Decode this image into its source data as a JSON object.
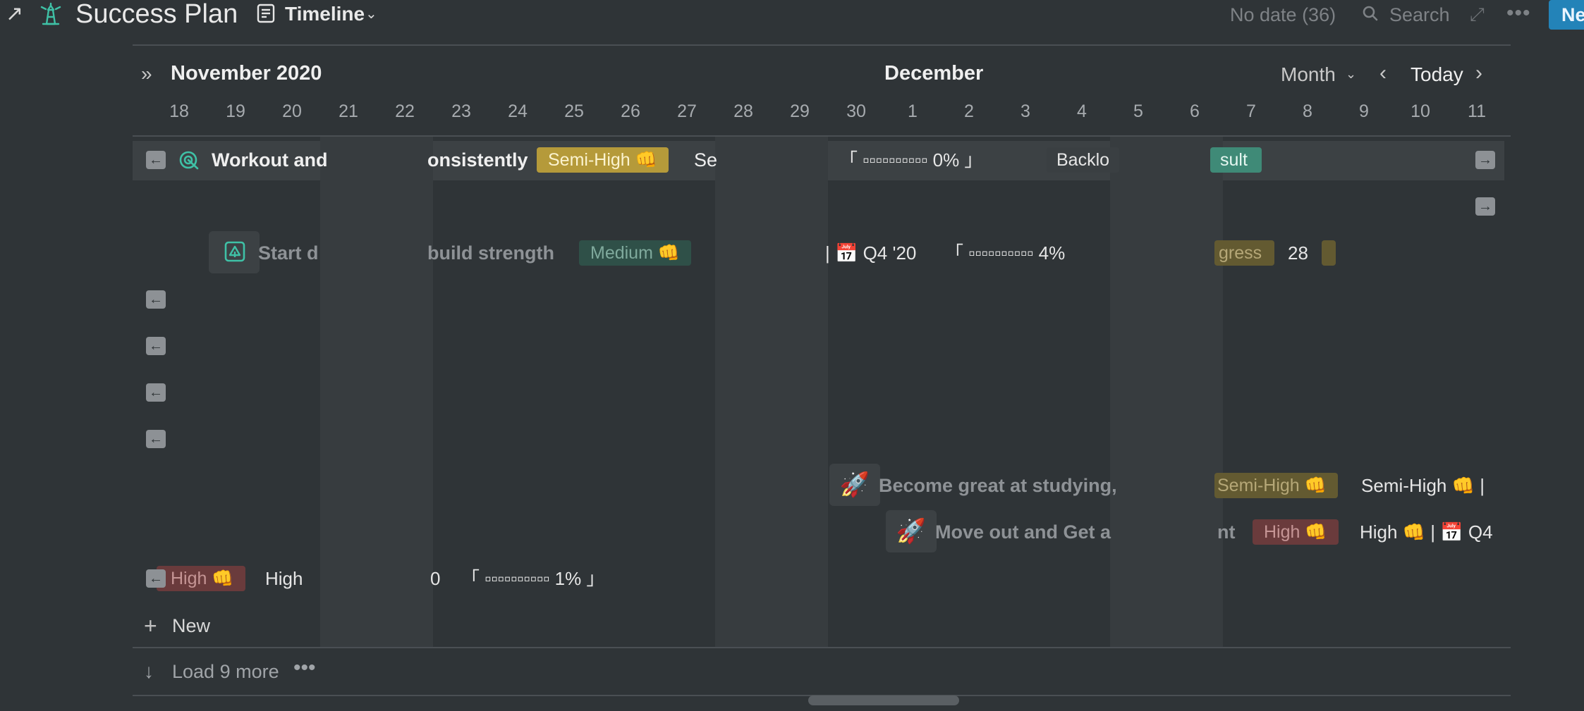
{
  "header": {
    "title": "Success Plan",
    "view_label": "Timeline",
    "no_date": "No date (36)",
    "search_label": "Search",
    "new_label": "New"
  },
  "timeline": {
    "month_left": "November 2020",
    "month_center": "December",
    "scale_label": "Month",
    "today_label": "Today",
    "days": [
      "18",
      "19",
      "20",
      "21",
      "22",
      "23",
      "24",
      "25",
      "26",
      "27",
      "28",
      "29",
      "30",
      "1",
      "2",
      "3",
      "4",
      "5",
      "6",
      "7",
      "8",
      "9",
      "10",
      "11"
    ]
  },
  "rows": {
    "r1": {
      "title_a": "Workout and",
      "title_b": "onsistently",
      "tag": "Semi-High ",
      "tag_emoji": "👊",
      "after_tag": "Se",
      "progress": "「 ▫▫▫▫▫▫▫▫▫▫ 0% 」",
      "backlog": "Backlo",
      "result": "sult"
    },
    "r2": {
      "title_a": "Start d",
      "title_b": "build strength",
      "tag": "Medium ",
      "tag_emoji": "👊",
      "quarter": "| 📅 Q4 '20",
      "progress": "「 ▫▫▫▫▫▫▫▫▫▫ 4%",
      "status": "gress",
      "number": "28"
    },
    "r3": {
      "title": "Become great at studying,",
      "tag": "Semi-High ",
      "tag_emoji": "👊",
      "after_tag": "Semi-High 👊 |"
    },
    "r4": {
      "title_a": "Move out and Get a",
      "title_b": "nt",
      "tag": "High ",
      "tag_emoji": "👊",
      "after_tag": "High 👊 | 📅 Q4"
    },
    "r5": {
      "tag": "High ",
      "tag_emoji": "👊",
      "after_tag": "High",
      "partial": "0",
      "progress": "「 ▫▫▫▫▫▫▫▫▫▫ 1% 」"
    }
  },
  "footer": {
    "new_label": "New",
    "load_more_label": "Load 9 more"
  }
}
